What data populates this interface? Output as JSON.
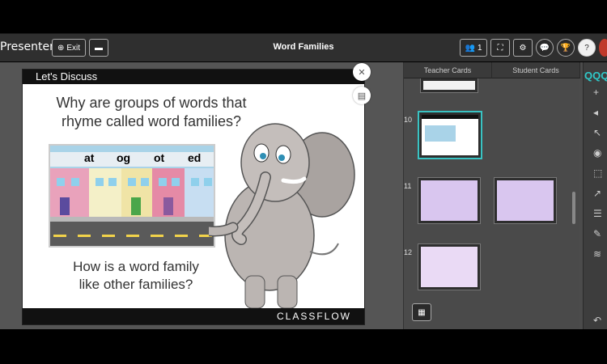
{
  "header": {
    "mode_label": "Presenter",
    "exit_label": "Exit",
    "title": "Word Families",
    "users_count": "1"
  },
  "slide": {
    "heading": "Let's Discuss",
    "question1_line1": "Why are groups of words that",
    "question1_line2": "rhyme called word families?",
    "question2_line1": "How is a word family",
    "question2_line2": "like other families?",
    "word_labels": [
      "at",
      "og",
      "ot",
      "ed"
    ],
    "brand": "CLASSFLOW"
  },
  "panel": {
    "tabs": [
      "Teacher Cards",
      "Student Cards"
    ],
    "card_numbers": [
      "10",
      "11",
      "12"
    ]
  },
  "right_bar": {
    "brand_partial": "QQQ"
  }
}
